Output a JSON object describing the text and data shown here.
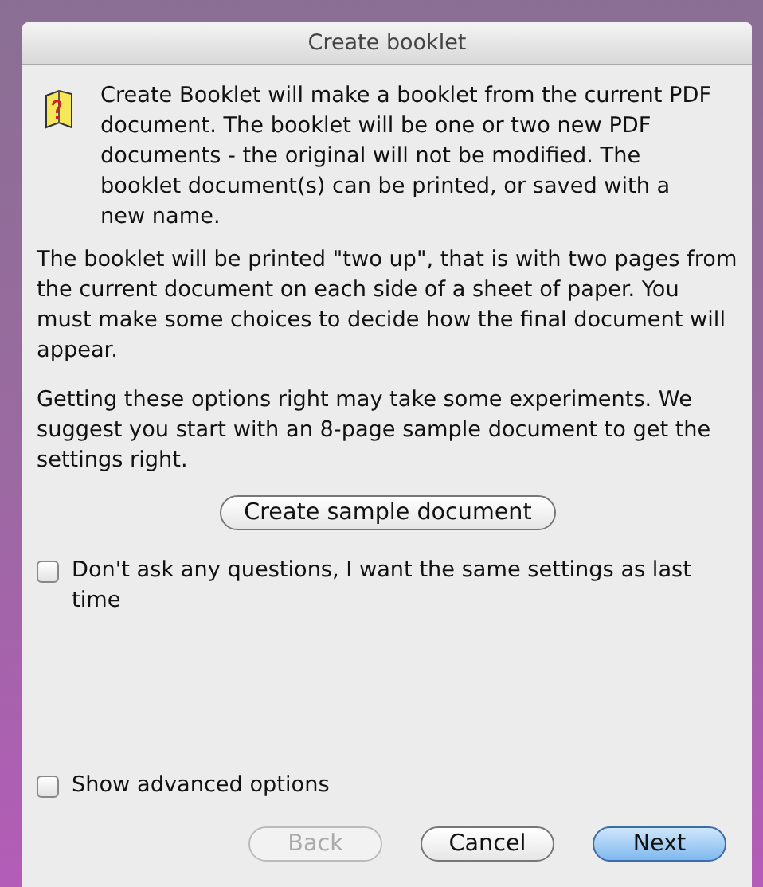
{
  "window": {
    "title": "Create booklet"
  },
  "intro": "Create Booklet will make a booklet from the current PDF document.  The booklet will be one or two new PDF documents - the original will not be modified.  The booklet document(s) can be printed, or saved with a new name.",
  "paragraphs": [
    "The booklet will be printed \"two up\", that is with two pages from the current document on each side of a sheet of paper. You must make some choices to decide how the final document will appear.",
    "Getting these options right may take some experiments.  We suggest you start with an 8-page sample document to get the settings right."
  ],
  "sample_button": {
    "label": "Create sample document"
  },
  "same_settings": {
    "label": "Don't ask any questions, I want the same settings as last time",
    "checked": false
  },
  "advanced": {
    "label": "Show advanced options",
    "checked": false
  },
  "buttons": [
    {
      "label": "Back",
      "disabled": true,
      "default": false
    },
    {
      "label": "Cancel",
      "disabled": false,
      "default": false
    },
    {
      "label": "Next",
      "disabled": false,
      "default": true
    }
  ]
}
